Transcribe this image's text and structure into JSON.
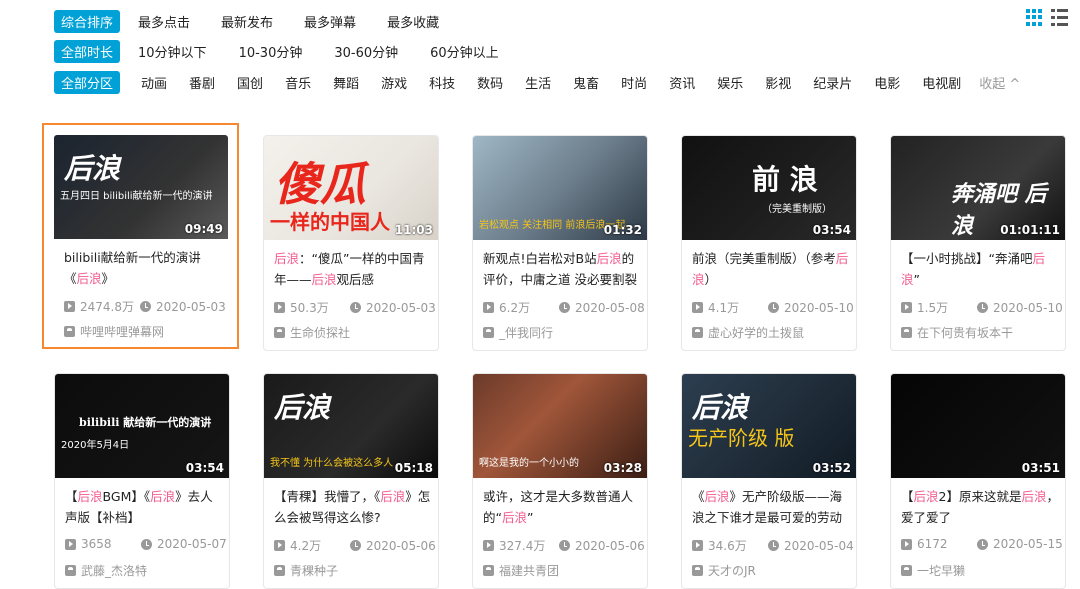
{
  "filters": {
    "sort": {
      "active": "综合排序",
      "options": [
        "最多点击",
        "最新发布",
        "最多弹幕",
        "最多收藏"
      ]
    },
    "duration": {
      "active": "全部时长",
      "options": [
        "10分钟以下",
        "10-30分钟",
        "30-60分钟",
        "60分钟以上"
      ]
    },
    "zone": {
      "active": "全部分区",
      "options": [
        "动画",
        "番剧",
        "国创",
        "音乐",
        "舞蹈",
        "游戏",
        "科技",
        "数码",
        "生活",
        "鬼畜",
        "时尚",
        "资讯",
        "娱乐",
        "影视",
        "纪录片",
        "电影",
        "电视剧"
      ],
      "collapse": "收起 ^"
    }
  },
  "videos": [
    {
      "title_parts": [
        [
          "bilibili献给新一代的演讲",
          false
        ],
        [
          "《",
          false
        ],
        [
          "后浪",
          true
        ],
        [
          "》",
          false
        ]
      ],
      "duration": "09:49",
      "plays": "2474.8万",
      "date": "2020-05-03",
      "uploader": "哔哩哔哩弹幕网",
      "thumb_text": "后浪",
      "thumb_sub": "五月四日 bilibili献给新一代的演讲"
    },
    {
      "title_parts": [
        [
          "后浪",
          true
        ],
        [
          "：“傻瓜”一样的中国青年——",
          false
        ],
        [
          "后浪",
          true
        ],
        [
          "观后感",
          false
        ]
      ],
      "duration": "11:03",
      "plays": "50.3万",
      "date": "2020-05-03",
      "uploader": "生命侦探社",
      "thumb_text": "傻瓜",
      "thumb_sub": "一样的中国人"
    },
    {
      "title_parts": [
        [
          "新观点!白岩松对B站",
          false
        ],
        [
          "后浪",
          true
        ],
        [
          "的评价，中庸之道 没必要割裂",
          false
        ]
      ],
      "duration": "01:32",
      "plays": "6.2万",
      "date": "2020-05-08",
      "uploader": "_伴我同行",
      "thumb_text": "",
      "thumb_sub": "岩松观点  关注相同 前浪后浪一起"
    },
    {
      "title_parts": [
        [
          "前浪（完美重制版）（参考",
          false
        ],
        [
          "后浪",
          true
        ],
        [
          "）",
          false
        ]
      ],
      "duration": "03:54",
      "plays": "4.1万",
      "date": "2020-05-10",
      "uploader": "虚心好学的土拨鼠",
      "thumb_text": "前 浪",
      "thumb_sub": "（完美重制版）"
    },
    {
      "title_parts": [
        [
          "【一小时挑战】“奔涌吧",
          false
        ],
        [
          "后浪",
          true
        ],
        [
          "”",
          false
        ]
      ],
      "duration": "01:01:11",
      "plays": "1.5万",
      "date": "2020-05-10",
      "uploader": "在下何贵有坂本干",
      "thumb_text": "奔涌吧 后浪",
      "thumb_sub": ""
    },
    {
      "title_parts": [
        [
          "【",
          false
        ],
        [
          "后浪",
          true
        ],
        [
          "BGM】《",
          false
        ],
        [
          "后浪",
          true
        ],
        [
          "》去人声版【补档】",
          false
        ]
      ],
      "duration": "03:54",
      "plays": "3658",
      "date": "2020-05-07",
      "uploader": "武藤_杰洛特",
      "thumb_text": "bilibili 献给新一代的演讲",
      "thumb_sub": "2020年5月4日"
    },
    {
      "title_parts": [
        [
          "【青稞】我懵了，《",
          false
        ],
        [
          "后浪",
          true
        ],
        [
          "》怎么会被骂得这么惨?",
          false
        ]
      ],
      "duration": "05:18",
      "plays": "4.2万",
      "date": "2020-05-06",
      "uploader": "青稞种子",
      "thumb_text": "后浪",
      "thumb_sub": "我不懂  为什么会被这么多人"
    },
    {
      "title_parts": [
        [
          "或许，这才是大多数普通人的“",
          false
        ],
        [
          "后浪",
          true
        ],
        [
          "”",
          false
        ]
      ],
      "duration": "03:28",
      "plays": "327.4万",
      "date": "2020-05-06",
      "uploader": "福建共青团",
      "thumb_text": "",
      "thumb_sub": "啊这是我的一个小小的"
    },
    {
      "title_parts": [
        [
          "《",
          false
        ],
        [
          "后浪",
          true
        ],
        [
          "》无产阶级版——海浪之下谁才是最可爱的劳动",
          false
        ]
      ],
      "duration": "03:52",
      "plays": "34.6万",
      "date": "2020-05-04",
      "uploader": "天才のJR",
      "thumb_text": "后浪",
      "thumb_sub": "无产阶级 版"
    },
    {
      "title_parts": [
        [
          "【",
          false
        ],
        [
          "后浪",
          true
        ],
        [
          "2】原来这就是",
          false
        ],
        [
          "后浪",
          true
        ],
        [
          "，爱了爱了",
          false
        ]
      ],
      "duration": "03:51",
      "plays": "6172",
      "date": "2020-05-15",
      "uploader": "一坨早獭",
      "thumb_text": "",
      "thumb_sub": ""
    }
  ],
  "colors": {
    "accent": "#00a1d6",
    "highlight": "#f25d8e",
    "selected_border": "#f7882f",
    "meta": "#999999"
  },
  "icons": {
    "grid_view": "grid-view-icon",
    "list_view": "list-view-icon",
    "play": "play-count-icon",
    "date": "clock-icon",
    "uploader": "up-icon"
  }
}
